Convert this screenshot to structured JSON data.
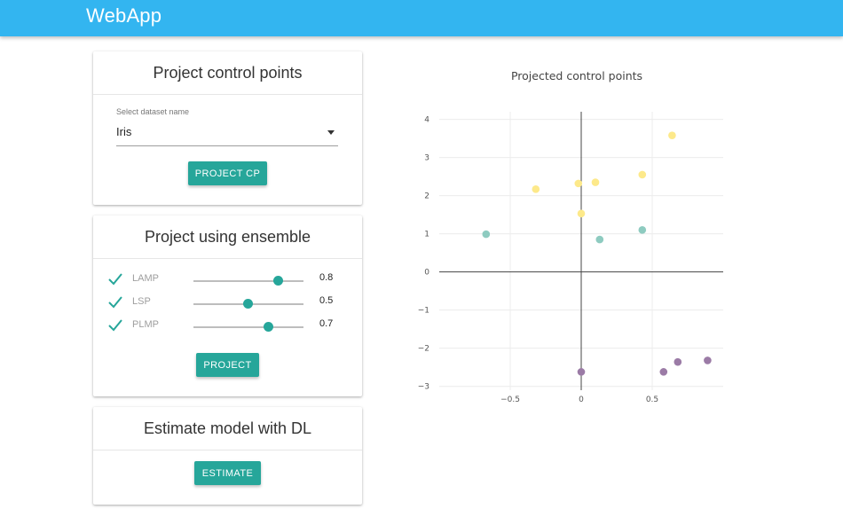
{
  "app": {
    "title": "WebApp"
  },
  "panel_cp": {
    "title": "Project control points",
    "select_label": "Select dataset name",
    "select_value": "Iris",
    "button": "PROJECT CP"
  },
  "panel_ensemble": {
    "title": "Project using ensemble",
    "rows": [
      {
        "label": "LAMP",
        "value": "0.8",
        "level": 0.8,
        "checked": true
      },
      {
        "label": "LSP",
        "value": "0.5",
        "level": 0.5,
        "checked": true
      },
      {
        "label": "PLMP",
        "value": "0.7",
        "level": 0.7,
        "checked": true
      }
    ],
    "button": "PROJECT"
  },
  "panel_dl": {
    "title": "Estimate model with DL",
    "button": "ESTIMATE"
  },
  "colors": {
    "appbar": "#33b5f0",
    "accent": "#26a69a"
  },
  "chart_data": {
    "type": "scatter",
    "title": "Projected control points",
    "xlabel": "",
    "ylabel": "",
    "xlim": [
      -1.0,
      1.0
    ],
    "ylim": [
      -3.1,
      4.2
    ],
    "xticks": [
      -0.5,
      0,
      0.5
    ],
    "xtick_labels": [
      "−0.5",
      "0",
      "0.5"
    ],
    "yticks": [
      4,
      3,
      2,
      1,
      0,
      -1,
      -2,
      -3
    ],
    "ytick_labels": [
      "4",
      "3",
      "2",
      "1",
      "0",
      "−1",
      "−2",
      "−3"
    ],
    "grid": true,
    "series": [
      {
        "color": "#fde98a",
        "points": [
          {
            "x": -0.32,
            "y": 2.17
          },
          {
            "x": -0.02,
            "y": 2.32
          },
          {
            "x": 0.1,
            "y": 2.35
          },
          {
            "x": 0.43,
            "y": 2.55
          },
          {
            "x": 0.64,
            "y": 3.58
          },
          {
            "x": 0.0,
            "y": 1.53
          }
        ]
      },
      {
        "color": "#8ecbc0",
        "points": [
          {
            "x": -0.67,
            "y": 0.99
          },
          {
            "x": 0.13,
            "y": 0.85
          },
          {
            "x": 0.43,
            "y": 1.1
          }
        ]
      },
      {
        "color": "#9b7ba6",
        "points": [
          {
            "x": 0.0,
            "y": -2.62
          },
          {
            "x": 0.58,
            "y": -2.62
          },
          {
            "x": 0.68,
            "y": -2.36
          },
          {
            "x": 0.89,
            "y": -2.32
          }
        ]
      }
    ]
  }
}
